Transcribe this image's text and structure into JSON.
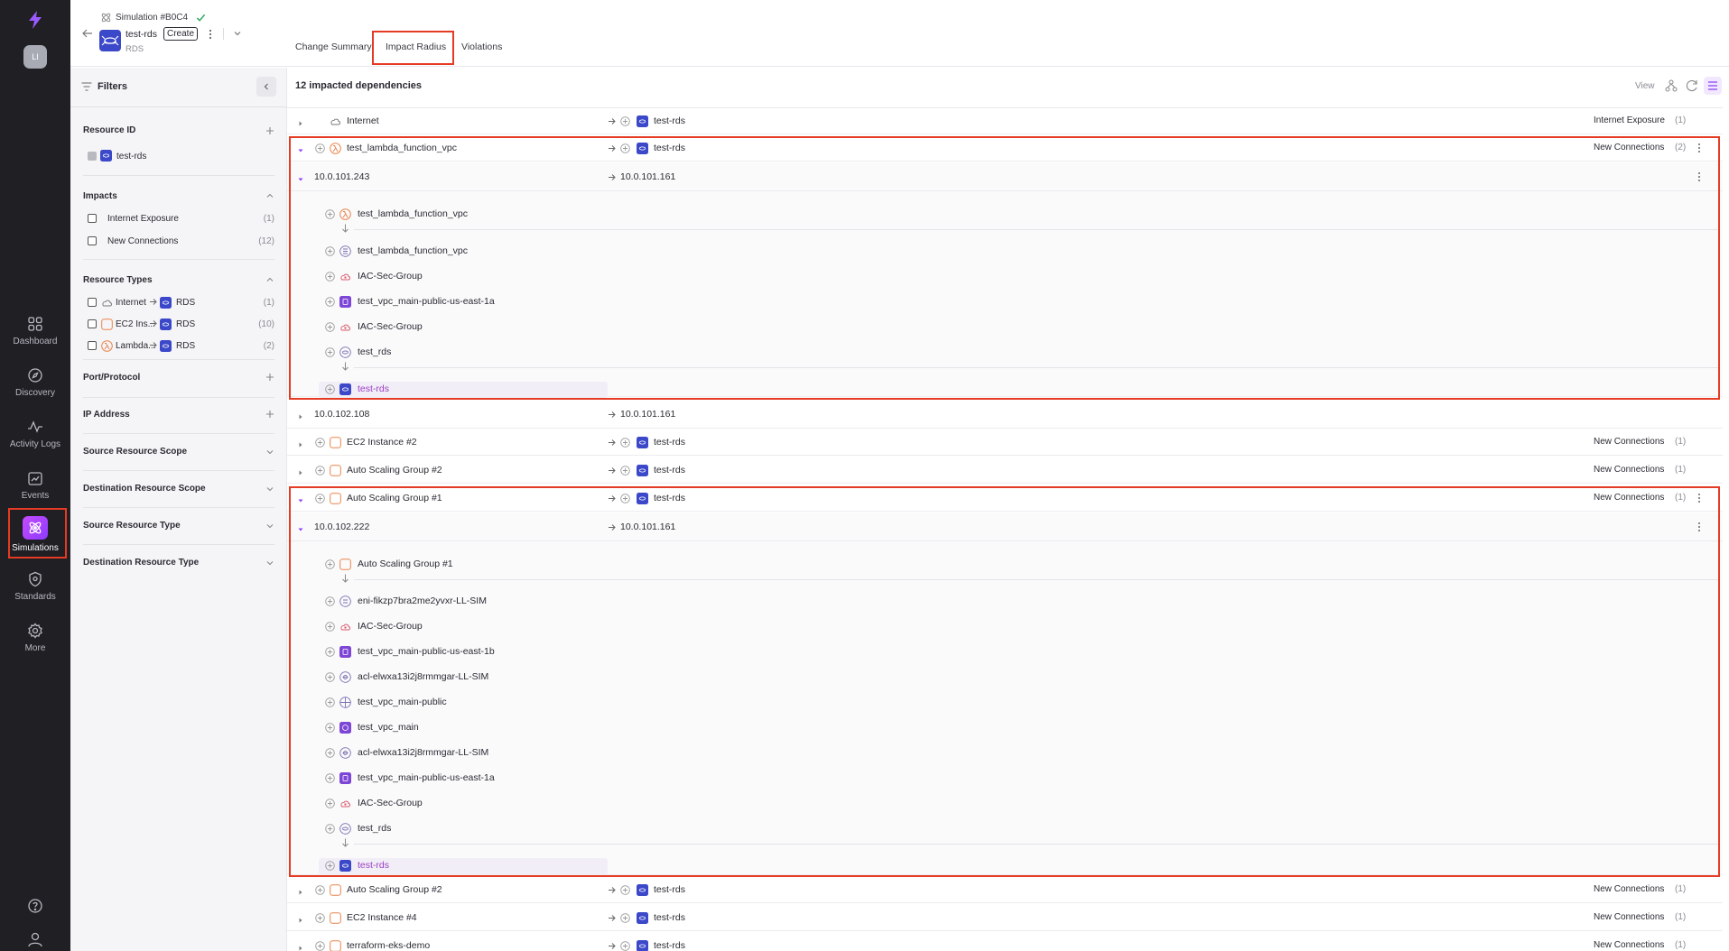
{
  "app": {
    "logo": "lightning-logo",
    "user_initials": "LI"
  },
  "nav": {
    "items": [
      {
        "label": "Dashboard",
        "icon": "dashboard-icon"
      },
      {
        "label": "Discovery",
        "icon": "compass-icon"
      },
      {
        "label": "Activity Logs",
        "icon": "pulse-icon"
      },
      {
        "label": "Events",
        "icon": "events-icon"
      },
      {
        "label": "Simulations",
        "icon": "atom-icon",
        "active": true
      },
      {
        "label": "Standards",
        "icon": "shield-icon"
      },
      {
        "label": "More",
        "icon": "gear-icon"
      }
    ],
    "bottom": [
      "help-icon",
      "profile-icon"
    ]
  },
  "header": {
    "simulation_title": "Simulation #B0C4",
    "resource_name": "test-rds",
    "badge": "Create",
    "resource_type": "RDS",
    "tabs": [
      "Change Summary",
      "Impact Radius",
      "Violations"
    ],
    "active_tab": "Impact Radius"
  },
  "filters": {
    "title": "Filters",
    "resource_id": {
      "title": "Resource ID",
      "items": [
        {
          "label": "test-rds",
          "checked": true
        }
      ]
    },
    "impacts": {
      "title": "Impacts",
      "items": [
        {
          "label": "Internet Exposure",
          "count": "(1)"
        },
        {
          "label": "New Connections",
          "count": "(12)"
        }
      ]
    },
    "resource_types": {
      "title": "Resource Types",
      "items": [
        {
          "from": "Internet",
          "to": "RDS",
          "count": "(1)"
        },
        {
          "from": "EC2 Ins...",
          "to": "RDS",
          "count": "(10)"
        },
        {
          "from": "Lambda...",
          "to": "RDS",
          "count": "(2)"
        }
      ]
    },
    "port_protocol": "Port/Protocol",
    "ip_address": "IP Address",
    "source_scope": "Source Resource Scope",
    "destination_scope": "Destination Resource Scope",
    "source_type": "Source Resource Type",
    "destination_type": "Destination Resource Type"
  },
  "main": {
    "title": "12 impacted dependencies",
    "view_label": "View",
    "rows": [
      {
        "source": "Internet",
        "target": "test-rds",
        "impact": "Internet Exposure",
        "count": "(1)"
      },
      {
        "source": "test_lambda_function_vpc",
        "target": "test-rds",
        "impact": "New Connections",
        "count": "(2)"
      },
      {
        "source": "10.0.101.243",
        "target": "10.0.101.161"
      },
      {
        "source": "10.0.102.108",
        "target": "10.0.101.161"
      },
      {
        "source": "EC2 Instance #2",
        "target": "test-rds",
        "impact": "New Connections",
        "count": "(1)"
      },
      {
        "source": "Auto Scaling Group #2",
        "target": "test-rds",
        "impact": "New Connections",
        "count": "(1)"
      },
      {
        "source": "Auto Scaling Group #1",
        "target": "test-rds",
        "impact": "New Connections",
        "count": "(1)"
      },
      {
        "source": "10.0.102.222",
        "target": "10.0.101.161"
      },
      {
        "source": "Auto Scaling Group #2",
        "target": "test-rds",
        "impact": "New Connections",
        "count": "(1)"
      },
      {
        "source": "EC2 Instance #4",
        "target": "test-rds",
        "impact": "New Connections",
        "count": "(1)"
      },
      {
        "source": "terraform-eks-demo",
        "target": "test-rds",
        "impact": "New Connections",
        "count": "(1)"
      }
    ],
    "path1": [
      "test_lambda_function_vpc",
      "test_lambda_function_vpc",
      "IAC-Sec-Group",
      "test_vpc_main-public-us-east-1a",
      "IAC-Sec-Group",
      "test_rds",
      "test-rds"
    ],
    "path2": [
      "Auto Scaling Group #1",
      "eni-fikzp7bra2me2yvxr-LL-SIM",
      "IAC-Sec-Group",
      "test_vpc_main-public-us-east-1b",
      "acl-elwxa13i2j8rmmgar-LL-SIM",
      "test_vpc_main-public",
      "test_vpc_main",
      "acl-elwxa13i2j8rmmgar-LL-SIM",
      "test_vpc_main-public-us-east-1a",
      "IAC-Sec-Group",
      "test_rds",
      "test-rds"
    ]
  },
  "colors": {
    "accent": "#8a3ffc",
    "highlight": "#e53a23",
    "rds": "#3b48c9",
    "orange": "#e9834b"
  }
}
